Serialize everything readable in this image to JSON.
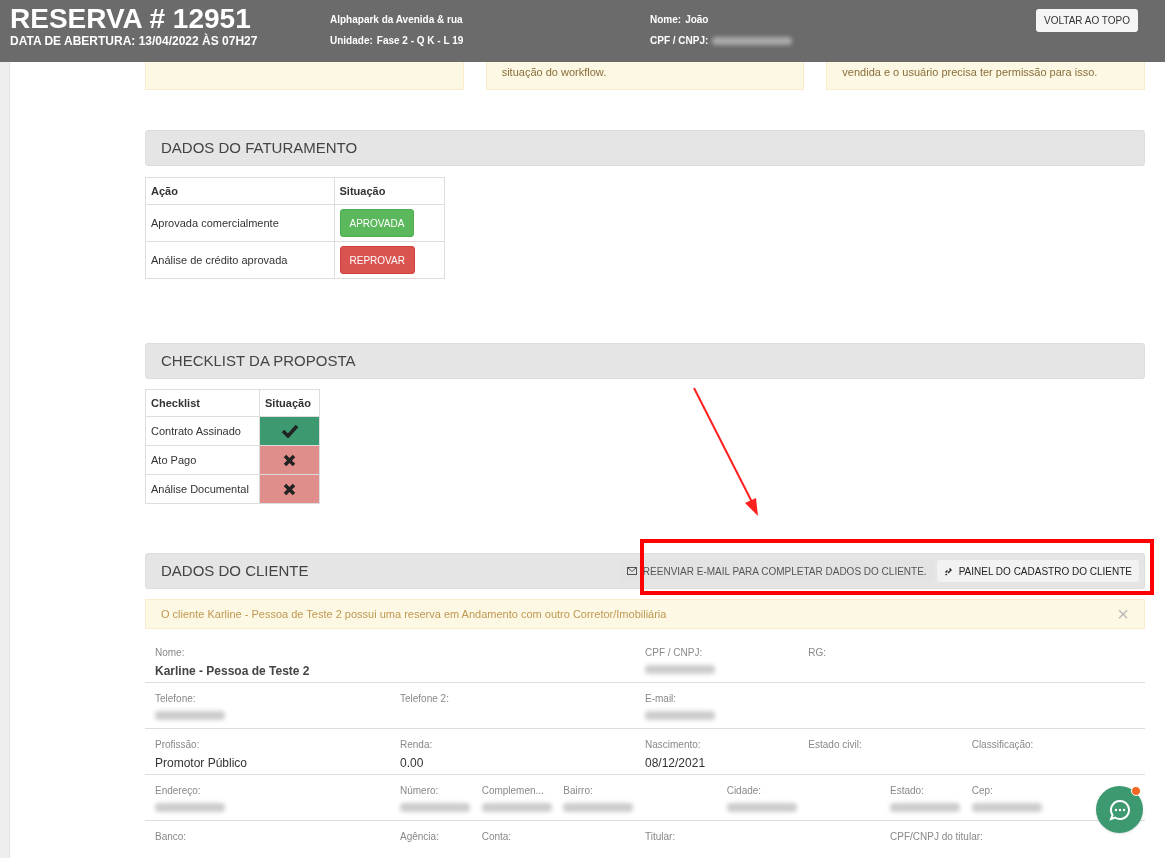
{
  "header": {
    "title": "RESERVA # 12951",
    "opened": "DATA DE ABERTURA: 13/04/2022 ÀS 07H27",
    "project": "Alphapark da Avenida & rua",
    "unit_label": "Unidade:",
    "unit": "Fase 2 - Q K - L 19",
    "name_label": "Nome:",
    "name": "João",
    "doc_label": "CPF / CNPJ:",
    "doc_redacted": true,
    "top_button": "VOLTAR AO TOPO"
  },
  "action_cards": [
    {
      "kind": "notice"
    },
    {
      "kind": "notice",
      "text": "situação do workflow."
    },
    {
      "kind": "notice",
      "text": "vendida e o usuário precisa ter permissão para isso."
    }
  ],
  "billing": {
    "title": "DADOS DO FATURAMENTO",
    "columns": [
      "Ação",
      "Situação"
    ],
    "rows": [
      {
        "action": "Aprovada comercialmente",
        "button": "APROVADA",
        "kind": "approved"
      },
      {
        "action": "Análise de crédito aprovada",
        "button": "REPROVAR",
        "kind": "reject"
      }
    ]
  },
  "checklist": {
    "title": "CHECKLIST DA PROPOSTA",
    "columns": [
      "Checklist",
      "Situação"
    ],
    "rows": [
      {
        "label": "Contrato Assinado",
        "done": true
      },
      {
        "label": "Ato Pago",
        "done": false
      },
      {
        "label": "Análise Documental",
        "done": false
      }
    ]
  },
  "client": {
    "title": "DADOS DO CLIENTE",
    "buttons": [
      {
        "label": "REENVIAR E-MAIL PARA COMPLETAR DADOS DO CLIENTE.",
        "kind": "mail"
      },
      {
        "label": "PAINEL DO CADASTRO DO CLIENTE",
        "kind": "link"
      }
    ],
    "alert": "O cliente Karline - Pessoa de Teste 2 possui uma reserva em Andamento com outro Corretor/Imobiliária",
    "alert_close": "×",
    "rows": [
      [
        {
          "label": "Nome:",
          "value": "Karline - Pessoa de Teste 2"
        },
        {
          "label": "CPF / CNPJ:",
          "redacted": true
        },
        {
          "label": "RG:"
        }
      ],
      [
        {
          "label": "Telefone:",
          "redacted": true
        },
        {
          "label": "Telefone 2:"
        },
        {
          "label": "E-mail:",
          "redacted": true
        }
      ],
      [
        {
          "label": "Profissão:",
          "value": "Promotor Público"
        },
        {
          "label": "Renda:",
          "value": "0.00"
        },
        {
          "label": "Nascimento:",
          "value": "08/12/2021"
        },
        {
          "label": "Estado civil:"
        },
        {
          "label": "Classificação:"
        }
      ],
      [
        {
          "label": "Endereço:",
          "redacted": true
        },
        {
          "label": "Número:",
          "redacted": true
        },
        {
          "label": "Complemen...",
          "redacted": true
        },
        {
          "label": "Bairro:",
          "redacted": true
        },
        {
          "label": "Cidade:",
          "redacted": true
        },
        {
          "label": "Estado:",
          "redacted": true
        },
        {
          "label": "Cep:",
          "redacted": true
        }
      ],
      [
        {
          "label": "Banco:"
        },
        {
          "label": "Agência:"
        },
        {
          "label": "Conta:"
        },
        {
          "label": "Titular:"
        },
        {
          "label": "CPF/CNPJ do titular:"
        }
      ]
    ]
  },
  "annotations": {
    "arrow": true,
    "highlight": true
  },
  "chat": {
    "unread": true
  }
}
